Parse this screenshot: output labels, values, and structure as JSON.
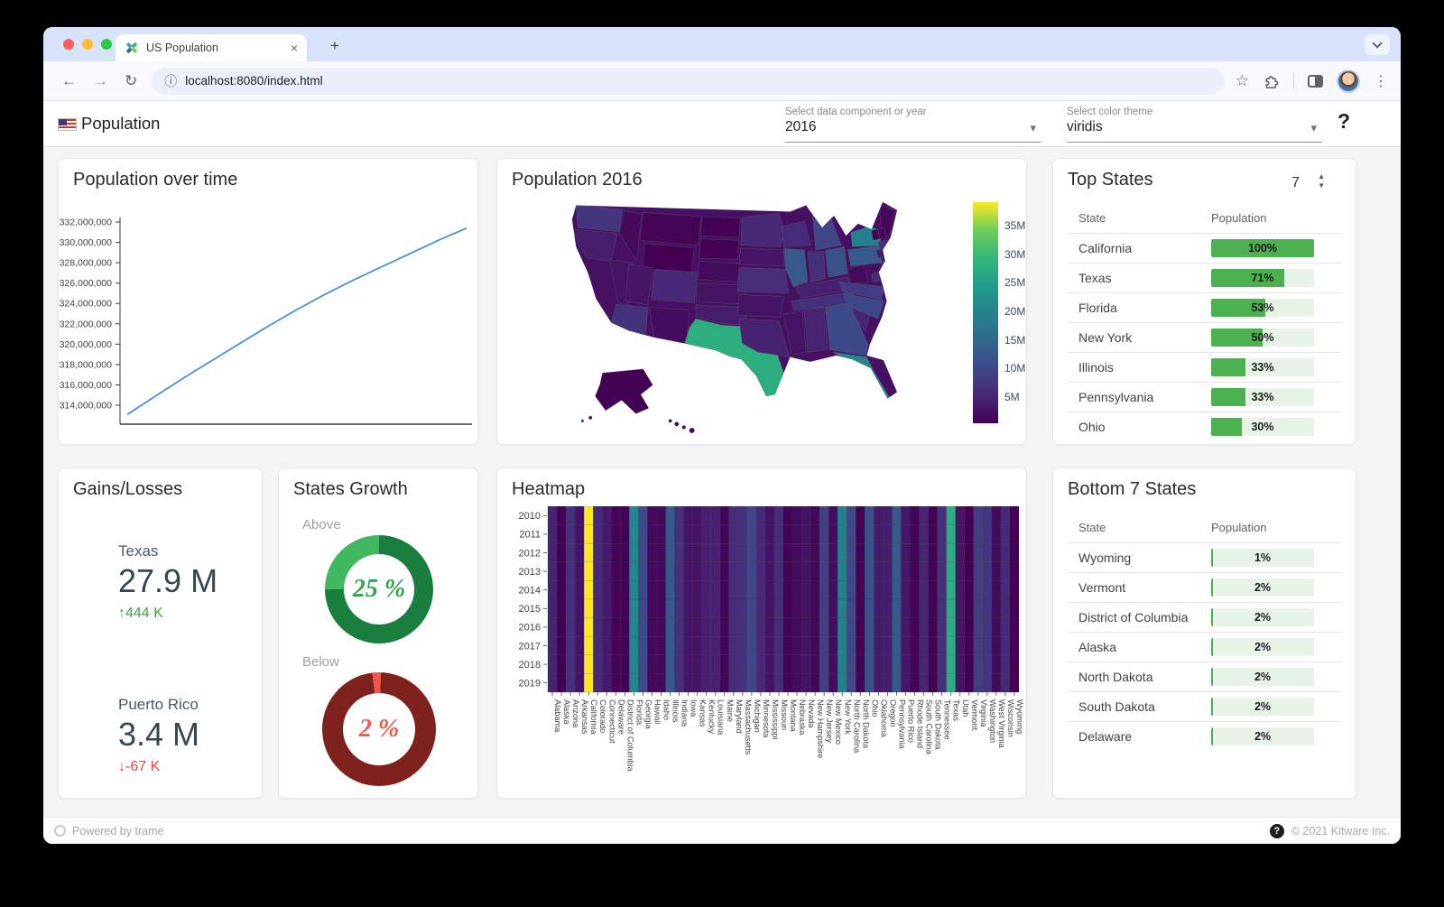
{
  "browser": {
    "tab_title": "US Population",
    "new_tab_label": "+",
    "close_label": "×",
    "url": "localhost:8080/index.html",
    "back_icon": "←",
    "forward_icon": "→",
    "reload_icon": "↻",
    "info_icon": "ⓘ",
    "star_icon": "☆",
    "menu_icon": "⋮"
  },
  "header": {
    "title": "Population",
    "year_select": {
      "label": "Select data component or year",
      "value": "2016"
    },
    "theme_select": {
      "label": "Select color theme",
      "value": "viridis"
    },
    "help_label": "?"
  },
  "cards": {
    "line": {
      "title": "Population over time"
    },
    "map": {
      "title": "Population 2016"
    },
    "top_states": {
      "title": "Top States",
      "count": "7",
      "col_state": "State",
      "col_population": "Population",
      "rows": [
        {
          "state": "California",
          "label": "100%",
          "pct": 100
        },
        {
          "state": "Texas",
          "label": "71%",
          "pct": 71
        },
        {
          "state": "Florida",
          "label": "53%",
          "pct": 53
        },
        {
          "state": "New York",
          "label": "50%",
          "pct": 50
        },
        {
          "state": "Illinois",
          "label": "33%",
          "pct": 33
        },
        {
          "state": "Pennsylvania",
          "label": "33%",
          "pct": 33
        },
        {
          "state": "Ohio",
          "label": "30%",
          "pct": 30
        }
      ]
    },
    "bottom_states": {
      "title": "Bottom 7 States",
      "col_state": "State",
      "col_population": "Population",
      "rows": [
        {
          "state": "Wyoming",
          "label": "1%",
          "pct": 1
        },
        {
          "state": "Vermont",
          "label": "2%",
          "pct": 2
        },
        {
          "state": "District of Columbia",
          "label": "2%",
          "pct": 2
        },
        {
          "state": "Alaska",
          "label": "2%",
          "pct": 2
        },
        {
          "state": "North Dakota",
          "label": "2%",
          "pct": 2
        },
        {
          "state": "South Dakota",
          "label": "2%",
          "pct": 2
        },
        {
          "state": "Delaware",
          "label": "2%",
          "pct": 2
        }
      ]
    },
    "gains": {
      "title": "Gains/Losses",
      "gain": {
        "state": "Texas",
        "value": "27.9 M",
        "delta": "↑444 K"
      },
      "loss": {
        "state": "Puerto Rico",
        "value": "3.4 M",
        "delta": "↓-67 K"
      }
    },
    "growth": {
      "title": "States Growth",
      "above_label": "Above",
      "above_text": "25 %",
      "above_pct": 25,
      "below_label": "Below",
      "below_text": "2 %",
      "below_pct": 2
    },
    "heatmap": {
      "title": "Heatmap"
    }
  },
  "footer": {
    "left": "Powered by trame",
    "badge": "?",
    "right": "© 2021 Kitware Inc."
  },
  "colors": {
    "bar_green": "#4caf50",
    "bar_track": "#e7f3e7",
    "delta_green": "#43a047",
    "delta_red": "#f44336",
    "line_blue": "#4a90d9",
    "donut_above_base": "#1a7e3e",
    "donut_above_arc": "#41b860",
    "donut_above_text": "#35a14f",
    "donut_below_base": "#7f211c",
    "donut_below_arc": "#f4564a",
    "donut_below_text": "#f4564a"
  },
  "chart_data": [
    {
      "type": "line",
      "title": "Population over time",
      "x_index": [
        0,
        1,
        2,
        3,
        4,
        5,
        6,
        7,
        8,
        9,
        10,
        11,
        12
      ],
      "values_millions": [
        313.1,
        314.9,
        316.7,
        318.4,
        320.1,
        321.8,
        323.4,
        324.9,
        326.3,
        327.6,
        328.9,
        330.2,
        331.4
      ],
      "y_ticks": [
        {
          "value": 332,
          "label": "332,000,000"
        },
        {
          "value": 330,
          "label": "330,000,000"
        },
        {
          "value": 328,
          "label": "328,000,000"
        },
        {
          "value": 326,
          "label": "326,000,000"
        },
        {
          "value": 324,
          "label": "324,000,000"
        },
        {
          "value": 322,
          "label": "322,000,000"
        },
        {
          "value": 320,
          "label": "320,000,000"
        },
        {
          "value": 318,
          "label": "318,000,000"
        },
        {
          "value": 316,
          "label": "316,000,000"
        },
        {
          "value": 314,
          "label": "314,000,000"
        }
      ],
      "grid": false,
      "legend": "none"
    },
    {
      "type": "heatmap",
      "subtype": "choropleth_us_map",
      "title": "Population 2016",
      "colorscale": "viridis",
      "unit": "millions",
      "domain_millions": [
        0.59,
        39.25
      ],
      "colorbar_ticks": [
        {
          "value": 35,
          "label": "35M"
        },
        {
          "value": 30,
          "label": "30M"
        },
        {
          "value": 25,
          "label": "25M"
        },
        {
          "value": 20,
          "label": "20M"
        },
        {
          "value": 15,
          "label": "15M"
        },
        {
          "value": 10,
          "label": "10M"
        },
        {
          "value": 5,
          "label": "5M"
        }
      ],
      "states": [
        {
          "name": "Alabama",
          "value_millions": 4.86
        },
        {
          "name": "Alaska",
          "value_millions": 0.74
        },
        {
          "name": "Arizona",
          "value_millions": 6.93
        },
        {
          "name": "Arkansas",
          "value_millions": 2.99
        },
        {
          "name": "California",
          "value_millions": 39.25
        },
        {
          "name": "Colorado",
          "value_millions": 5.54
        },
        {
          "name": "Connecticut",
          "value_millions": 3.58
        },
        {
          "name": "Delaware",
          "value_millions": 0.95
        },
        {
          "name": "District of Columbia",
          "value_millions": 0.68
        },
        {
          "name": "Florida",
          "value_millions": 20.61
        },
        {
          "name": "Georgia",
          "value_millions": 10.31
        },
        {
          "name": "Hawaii",
          "value_millions": 1.43
        },
        {
          "name": "Idaho",
          "value_millions": 1.68
        },
        {
          "name": "Illinois",
          "value_millions": 12.8
        },
        {
          "name": "Indiana",
          "value_millions": 6.63
        },
        {
          "name": "Iowa",
          "value_millions": 3.13
        },
        {
          "name": "Kansas",
          "value_millions": 2.91
        },
        {
          "name": "Kentucky",
          "value_millions": 4.44
        },
        {
          "name": "Louisiana",
          "value_millions": 4.68
        },
        {
          "name": "Maine",
          "value_millions": 1.33
        },
        {
          "name": "Maryland",
          "value_millions": 6.02
        },
        {
          "name": "Massachusetts",
          "value_millions": 6.81
        },
        {
          "name": "Michigan",
          "value_millions": 9.93
        },
        {
          "name": "Minnesota",
          "value_millions": 5.52
        },
        {
          "name": "Mississippi",
          "value_millions": 2.99
        },
        {
          "name": "Missouri",
          "value_millions": 6.09
        },
        {
          "name": "Montana",
          "value_millions": 1.04
        },
        {
          "name": "Nebraska",
          "value_millions": 1.91
        },
        {
          "name": "Nevada",
          "value_millions": 2.94
        },
        {
          "name": "New Hampshire",
          "value_millions": 1.33
        },
        {
          "name": "New Jersey",
          "value_millions": 8.94
        },
        {
          "name": "New Mexico",
          "value_millions": 2.08
        },
        {
          "name": "New York",
          "value_millions": 19.75
        },
        {
          "name": "North Carolina",
          "value_millions": 10.15
        },
        {
          "name": "North Dakota",
          "value_millions": 0.76
        },
        {
          "name": "Ohio",
          "value_millions": 11.61
        },
        {
          "name": "Oklahoma",
          "value_millions": 3.92
        },
        {
          "name": "Oregon",
          "value_millions": 4.09
        },
        {
          "name": "Pennsylvania",
          "value_millions": 12.78
        },
        {
          "name": "Puerto Rico",
          "value_millions": 3.41
        },
        {
          "name": "Rhode Island",
          "value_millions": 1.06
        },
        {
          "name": "South Carolina",
          "value_millions": 4.96
        },
        {
          "name": "South Dakota",
          "value_millions": 0.87
        },
        {
          "name": "Tennessee",
          "value_millions": 6.65
        },
        {
          "name": "Texas",
          "value_millions": 27.86
        },
        {
          "name": "Utah",
          "value_millions": 3.05
        },
        {
          "name": "Vermont",
          "value_millions": 0.62
        },
        {
          "name": "Virginia",
          "value_millions": 8.41
        },
        {
          "name": "Washington",
          "value_millions": 7.29
        },
        {
          "name": "West Virginia",
          "value_millions": 1.83
        },
        {
          "name": "Wisconsin",
          "value_millions": 5.78
        },
        {
          "name": "Wyoming",
          "value_millions": 0.59
        }
      ]
    },
    {
      "type": "heatmap",
      "title": "Heatmap",
      "rows_years": [
        "2010",
        "2011",
        "2012",
        "2013",
        "2014",
        "2015",
        "2016",
        "2017",
        "2018",
        "2019"
      ],
      "columns_states_source": "chart_data[1].states (alphabetical, same order)",
      "values_note": "cell color = state population (millions), constant per column",
      "colorscale": "viridis"
    }
  ]
}
